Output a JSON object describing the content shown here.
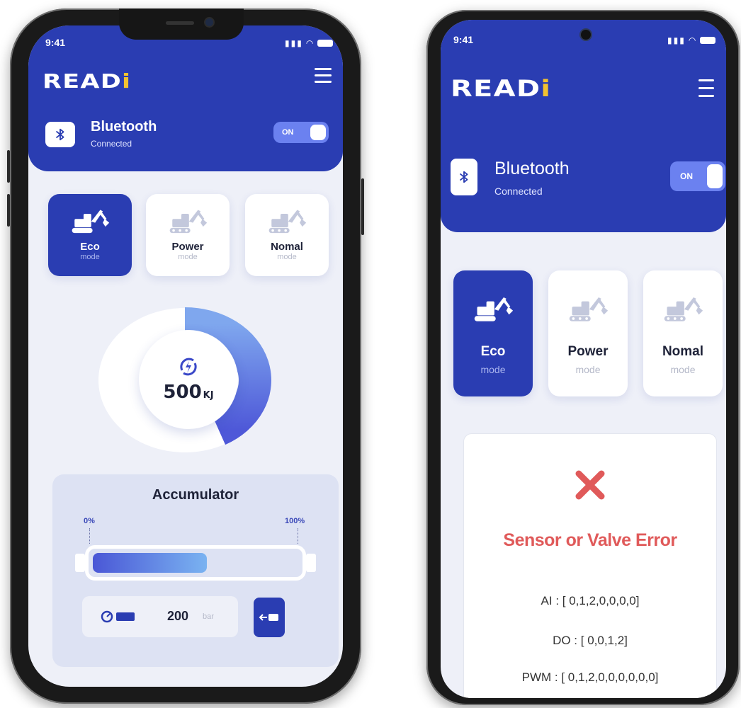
{
  "phone_left": {
    "status_time": "9:41",
    "brand": {
      "text": "READ",
      "accent": "i"
    },
    "bluetooth": {
      "title": "Bluetooth",
      "status": "Connected",
      "toggle_label": "ON"
    },
    "modes": [
      {
        "name": "Eco",
        "sub": "mode",
        "active": true
      },
      {
        "name": "Power",
        "sub": "mode",
        "active": false
      },
      {
        "name": "Nomal",
        "sub": "mode",
        "active": false
      }
    ],
    "energy": {
      "value": "500",
      "unit": "KJ",
      "level_fraction": 0.42
    },
    "accumulator": {
      "title": "Accumulator",
      "min_label": "0%",
      "max_label": "100%",
      "fill_fraction": 0.55,
      "pressure_value": "200",
      "pressure_unit": "bar"
    }
  },
  "phone_right": {
    "status_time": "9:41",
    "brand": {
      "text": "READ",
      "accent": "i"
    },
    "bluetooth": {
      "title": "Bluetooth",
      "status": "Connected",
      "toggle_label": "ON"
    },
    "modes": [
      {
        "name": "Eco",
        "sub": "mode",
        "active": true
      },
      {
        "name": "Power",
        "sub": "mode",
        "active": false
      },
      {
        "name": "Nomal",
        "sub": "mode",
        "active": false
      }
    ],
    "error": {
      "title": "Sensor  or Valve Error",
      "lines": [
        "AI : [ 0,1,2,0,0,0,0]",
        "DO : [ 0,0,1,2]",
        "PWM : [ 0,1,2,0,0,0,0,0,0]"
      ]
    }
  },
  "colors": {
    "primary": "#2a3db2",
    "accent_toggle": "#6b81f0",
    "error": "#e05a5a",
    "background": "#eef0f8",
    "logo_dot": "#f2c230"
  }
}
